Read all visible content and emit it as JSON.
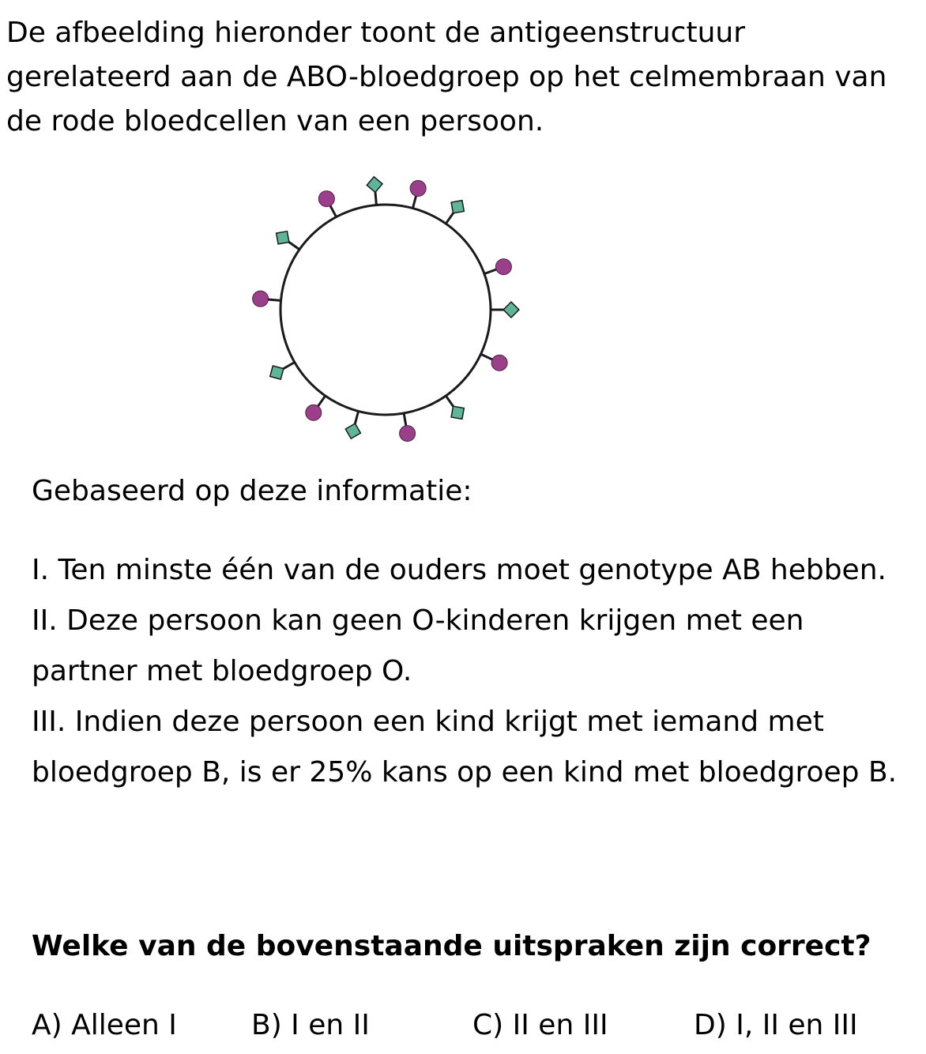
{
  "intro": "De afbeelding hieronder toont de antigeenstructuur gerelateerd aan de ABO-bloedgroep op het celmembraan van de rode bloedcellen van een persoon.",
  "figure": {
    "membrane_icon": "cell-membrane-circle",
    "antigen_a_icon": "diamond-marker",
    "antigen_b_icon": "round-marker",
    "colors": {
      "membrane": "#1a1a1a",
      "antigen_diamond": "#5fb59a",
      "antigen_round": "#9b3f8a"
    }
  },
  "lead": "Gebaseerd op deze informatie:",
  "statements": [
    "I. Ten minste één van de ouders moet genotype AB hebben.",
    "II. Deze persoon kan geen O-kinderen krijgen met een partner met bloedgroep O.",
    "III. Indien deze persoon een kind krijgt met iemand met bloedgroep B, is er 25% kans op een kind met bloedgroep B."
  ],
  "question": "Welke van de bovenstaande uitspraken zijn correct?",
  "options": [
    "A) Alleen I",
    "B) I en II",
    "C) II en III",
    "D) I, II en III"
  ]
}
